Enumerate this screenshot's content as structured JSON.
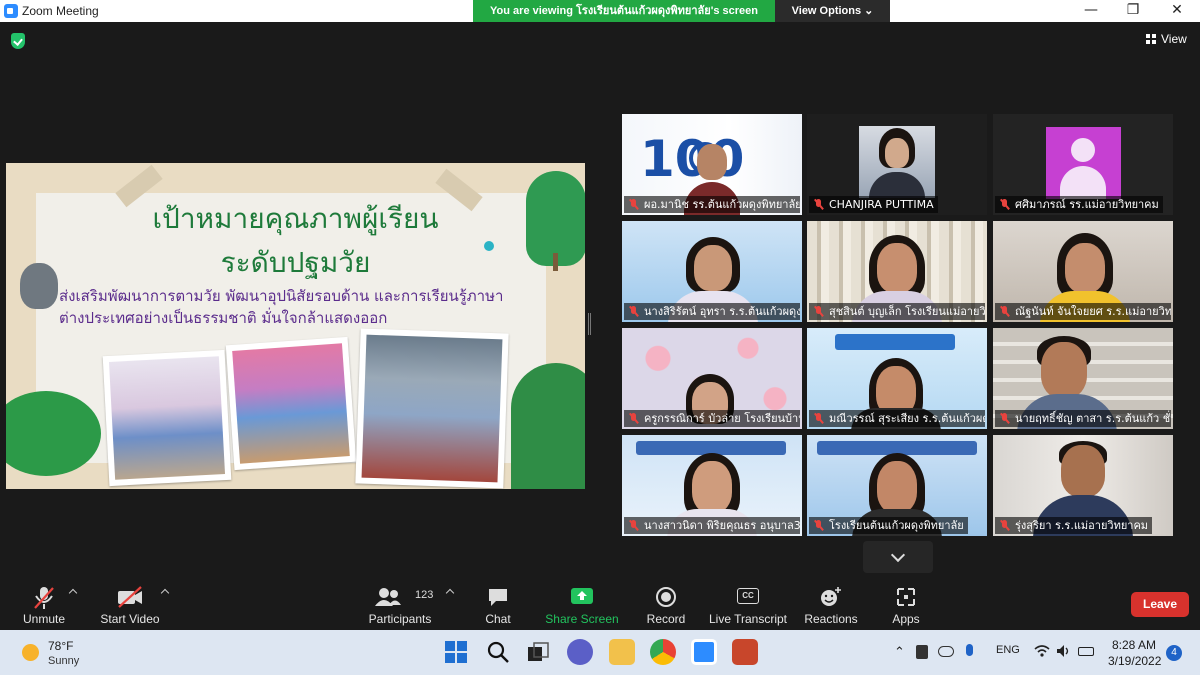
{
  "titlebar": {
    "app_title": "Zoom Meeting",
    "viewing_banner": "You are viewing โรงเรียนต้นแก้วผดุงพิทยาลัย's screen",
    "view_options": "View Options ⌄",
    "minimize": "—",
    "maximize": "❐",
    "close": "✕"
  },
  "meeting": {
    "view_label": "View"
  },
  "slide": {
    "title_line1": "เป้าหมายคุณภาพผู้เรียน",
    "title_line2": "ระดับปฐมวัย",
    "goal_text": "ส่งเสริมพัฒนาการตามวัย พัฒนาอุปนิสัยรอบด้าน และการเรียนรู้ภาษาต่างประเทศอย่างเป็นธรรมชาติ มั่นใจกล้าแสดงออก"
  },
  "participants": [
    {
      "name": "ผอ.มานิช รร.ต้นแก้วผดุงพิทยาลัย",
      "muted": true
    },
    {
      "name": "CHANJIRA PUTTIMA",
      "muted": true
    },
    {
      "name": "ศศิมาภรณ์ รร.แม่อายวิทยาคม",
      "muted": true
    },
    {
      "name": "นางสิริรัตน์ อุทรา ร.ร.ต้นแก้วผดุงพิทยาลัย",
      "muted": true
    },
    {
      "name": "สุชสินต์ บุญเล็ก โรงเรียนแม่อายวิทยาคม",
      "muted": true
    },
    {
      "name": "ณัฐนันท์ จันใจยยศ ร.ร.แม่อายวิทยาคม",
      "muted": true
    },
    {
      "name": "ครูกรรณิการ์ บัวล่าย โรงเรียนบ้านถ้ำ",
      "muted": true
    },
    {
      "name": "มณีวรรณ์ สุระเสียง ร.ร.ต้นแก้วผดุงพิทยาลัย",
      "muted": true,
      "active_speaker": true
    },
    {
      "name": "นายฤทธิ์ชัญ ตาสา ร.ร.ต้นแก้ว ชั่วคราว",
      "muted": true
    },
    {
      "name": "นางสาวนิดา พิริยคุณธร อนุบาล3",
      "muted": true
    },
    {
      "name": "โรงเรียนต้นแก้วผดุงพิทยาลัย",
      "muted": true
    },
    {
      "name": "รุ่งสุริยา ร.ร.แม่อายวิทยาคม",
      "muted": true
    }
  ],
  "toolbar": {
    "unmute": "Unmute",
    "start_video": "Start Video",
    "participants": "Participants",
    "participant_count": "123",
    "chat": "Chat",
    "share_screen": "Share Screen",
    "record": "Record",
    "live_transcript": "Live Transcript",
    "cc": "CC",
    "reactions": "Reactions",
    "apps": "Apps",
    "leave": "Leave"
  },
  "taskbar": {
    "temperature": "78°F",
    "condition": "Sunny",
    "language": "ENG",
    "time": "8:28 AM",
    "date": "3/19/2022",
    "notifications": "4"
  },
  "colors": {
    "banner_green": "#22a843",
    "share_green": "#22c35e",
    "leave_red": "#d8322d",
    "mute_red": "#e8433e",
    "active_speaker": "#f6e56a"
  }
}
